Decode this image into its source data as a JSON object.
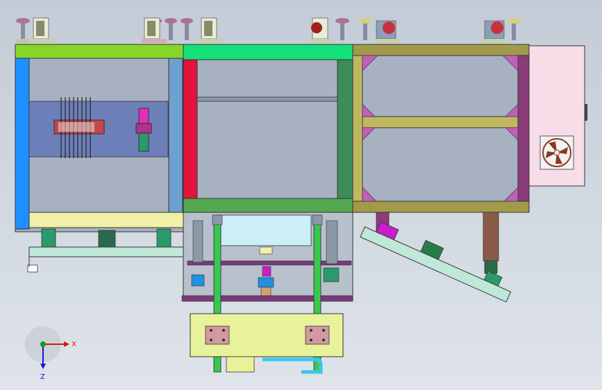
{
  "view": {
    "background_top": "#c3cbd6",
    "background_bottom": "#dfe4ea"
  },
  "triad": {
    "x_label": "X",
    "z_label": "Z",
    "x_color": "#e01010",
    "z_color": "#1818d0",
    "y_color": "#10a010"
  },
  "colors": {
    "left_frame_top": "#86d62a",
    "left_frame_side": "#1e90ff",
    "left_frame_right": "#6ea0d0",
    "left_bottom_rail": "#f2efa6",
    "mid_frame_top": "#14e07a",
    "mid_frame_left": "#e0143c",
    "mid_frame_right": "#3d8c5a",
    "mid_frame_bottom": "#55a84f",
    "right_frame": "#a09a4a",
    "right_panel": "#8a3d7a",
    "fan_box": "#f6dde8",
    "fan_blade": "#8a3a22",
    "plate": "#e8f29a",
    "conveyor_rail": "#bfe8d8",
    "magenta": "#c81ecb"
  }
}
